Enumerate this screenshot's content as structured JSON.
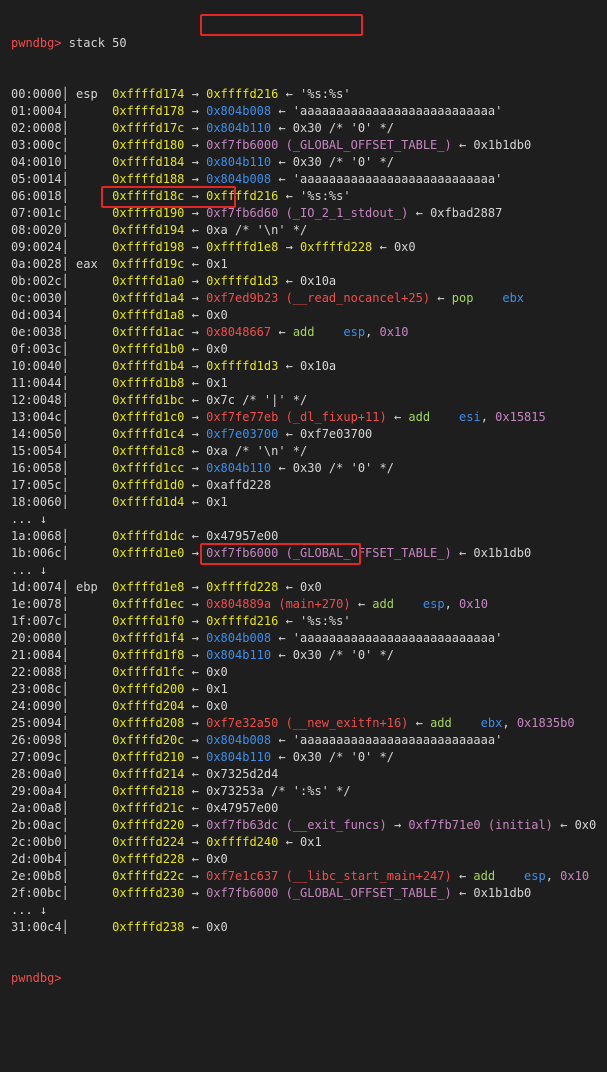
{
  "terminal": {
    "prompt": "pwndbg>",
    "command": " stack 50",
    "lines": [
      [
        [
          "00:0000",
          "plain"
        ],
        [
          "│ esp  ",
          "plain"
        ],
        [
          "0xffffd174",
          "addr"
        ],
        [
          " → ",
          "plain"
        ],
        [
          "0xffffd216",
          "addr"
        ],
        [
          " ← '%s:%s'",
          "plain"
        ]
      ],
      [
        [
          "01:0004",
          "plain"
        ],
        [
          "│      ",
          "plain"
        ],
        [
          "0xffffd178",
          "addr"
        ],
        [
          " → ",
          "plain"
        ],
        [
          "0x804b008",
          "blue"
        ],
        [
          " ← 'aaaaaaaaaaaaaaaaaaaaaaaaaaa'",
          "plain"
        ]
      ],
      [
        [
          "02:0008",
          "plain"
        ],
        [
          "│      ",
          "plain"
        ],
        [
          "0xffffd17c",
          "addr"
        ],
        [
          " → ",
          "plain"
        ],
        [
          "0x804b110",
          "blue"
        ],
        [
          " ← 0x30 /* '0' */",
          "plain"
        ]
      ],
      [
        [
          "03:000c",
          "plain"
        ],
        [
          "│      ",
          "plain"
        ],
        [
          "0xffffd180",
          "addr"
        ],
        [
          " → ",
          "plain"
        ],
        [
          "0xf7fb6000",
          "sym"
        ],
        [
          " (_GLOBAL_OFFSET_TABLE_)",
          "sym"
        ],
        [
          " ← 0x1b1db0",
          "plain"
        ]
      ],
      [
        [
          "04:0010",
          "plain"
        ],
        [
          "│      ",
          "plain"
        ],
        [
          "0xffffd184",
          "addr"
        ],
        [
          " → ",
          "plain"
        ],
        [
          "0x804b110",
          "blue"
        ],
        [
          " ← 0x30 /* '0' */",
          "plain"
        ]
      ],
      [
        [
          "05:0014",
          "plain"
        ],
        [
          "│      ",
          "plain"
        ],
        [
          "0xffffd188",
          "addr"
        ],
        [
          " → ",
          "plain"
        ],
        [
          "0x804b008",
          "blue"
        ],
        [
          " ← 'aaaaaaaaaaaaaaaaaaaaaaaaaaa'",
          "plain"
        ]
      ],
      [
        [
          "06:0018",
          "plain"
        ],
        [
          "│      ",
          "plain"
        ],
        [
          "0xffffd18c",
          "addr"
        ],
        [
          " → ",
          "plain"
        ],
        [
          "0xffffd216",
          "addr"
        ],
        [
          " ← '%s:%s'",
          "plain"
        ]
      ],
      [
        [
          "07:001c",
          "plain"
        ],
        [
          "│      ",
          "plain"
        ],
        [
          "0xffffd190",
          "addr"
        ],
        [
          " → ",
          "plain"
        ],
        [
          "0xf7fb6d60",
          "sym"
        ],
        [
          " (_IO_2_1_stdout_)",
          "sym"
        ],
        [
          " ← 0xfbad2887",
          "plain"
        ]
      ],
      [
        [
          "08:0020",
          "plain"
        ],
        [
          "│      ",
          "plain"
        ],
        [
          "0xffffd194",
          "addr"
        ],
        [
          " ← 0xa /* '\\n' */",
          "plain"
        ]
      ],
      [
        [
          "09:0024",
          "plain"
        ],
        [
          "│      ",
          "plain"
        ],
        [
          "0xffffd198",
          "addr"
        ],
        [
          " → ",
          "plain"
        ],
        [
          "0xffffd1e8",
          "addr"
        ],
        [
          " → ",
          "plain"
        ],
        [
          "0xffffd228",
          "addr"
        ],
        [
          " ← 0x0",
          "plain"
        ]
      ],
      [
        [
          "0a:0028",
          "plain"
        ],
        [
          "│ eax  ",
          "plain"
        ],
        [
          "0xffffd19c",
          "addr"
        ],
        [
          " ← 0x1",
          "plain"
        ]
      ],
      [
        [
          "0b:002c",
          "plain"
        ],
        [
          "│      ",
          "plain"
        ],
        [
          "0xffffd1a0",
          "addr"
        ],
        [
          " → ",
          "plain"
        ],
        [
          "0xffffd1d3",
          "addr"
        ],
        [
          " ← 0x10a",
          "plain"
        ]
      ],
      [
        [
          "0c:0030",
          "plain"
        ],
        [
          "│      ",
          "plain"
        ],
        [
          "0xffffd1a4",
          "addr"
        ],
        [
          " → ",
          "plain"
        ],
        [
          "0xf7ed9b23",
          "code"
        ],
        [
          " (__read_nocancel+25)",
          "code"
        ],
        [
          " ← ",
          "plain"
        ],
        [
          "pop",
          "ins"
        ],
        [
          "    ",
          "plain"
        ],
        [
          "ebx",
          "reg"
        ]
      ],
      [
        [
          "0d:0034",
          "plain"
        ],
        [
          "│      ",
          "plain"
        ],
        [
          "0xffffd1a8",
          "addr"
        ],
        [
          " ← 0x0",
          "plain"
        ]
      ],
      [
        [
          "0e:0038",
          "plain"
        ],
        [
          "│      ",
          "plain"
        ],
        [
          "0xffffd1ac",
          "addr"
        ],
        [
          " → ",
          "plain"
        ],
        [
          "0x8048667",
          "code"
        ],
        [
          " ← ",
          "plain"
        ],
        [
          "add",
          "ins"
        ],
        [
          "    ",
          "plain"
        ],
        [
          "esp",
          "reg"
        ],
        [
          ", ",
          "plain"
        ],
        [
          "0x10",
          "imm"
        ]
      ],
      [
        [
          "0f:003c",
          "plain"
        ],
        [
          "│      ",
          "plain"
        ],
        [
          "0xffffd1b0",
          "addr"
        ],
        [
          " ← 0x0",
          "plain"
        ]
      ],
      [
        [
          "10:0040",
          "plain"
        ],
        [
          "│      ",
          "plain"
        ],
        [
          "0xffffd1b4",
          "addr"
        ],
        [
          " → ",
          "plain"
        ],
        [
          "0xffffd1d3",
          "addr"
        ],
        [
          " ← 0x10a",
          "plain"
        ]
      ],
      [
        [
          "11:0044",
          "plain"
        ],
        [
          "│      ",
          "plain"
        ],
        [
          "0xffffd1b8",
          "addr"
        ],
        [
          " ← 0x1",
          "plain"
        ]
      ],
      [
        [
          "12:0048",
          "plain"
        ],
        [
          "│      ",
          "plain"
        ],
        [
          "0xffffd1bc",
          "addr"
        ],
        [
          " ← 0x7c /* '|' */",
          "plain"
        ]
      ],
      [
        [
          "13:004c",
          "plain"
        ],
        [
          "│      ",
          "plain"
        ],
        [
          "0xffffd1c0",
          "addr"
        ],
        [
          " → ",
          "plain"
        ],
        [
          "0xf7fe77eb",
          "code"
        ],
        [
          " (_dl_fixup+11)",
          "code"
        ],
        [
          " ← ",
          "plain"
        ],
        [
          "add",
          "ins"
        ],
        [
          "    ",
          "plain"
        ],
        [
          "esi",
          "reg"
        ],
        [
          ", ",
          "plain"
        ],
        [
          "0x15815",
          "imm"
        ]
      ],
      [
        [
          "14:0050",
          "plain"
        ],
        [
          "│      ",
          "plain"
        ],
        [
          "0xffffd1c4",
          "addr"
        ],
        [
          " → ",
          "plain"
        ],
        [
          "0xf7e03700",
          "blue"
        ],
        [
          " ← 0xf7e03700",
          "plain"
        ]
      ],
      [
        [
          "15:0054",
          "plain"
        ],
        [
          "│      ",
          "plain"
        ],
        [
          "0xffffd1c8",
          "addr"
        ],
        [
          " ← 0xa /* '\\n' */",
          "plain"
        ]
      ],
      [
        [
          "16:0058",
          "plain"
        ],
        [
          "│      ",
          "plain"
        ],
        [
          "0xffffd1cc",
          "addr"
        ],
        [
          " → ",
          "plain"
        ],
        [
          "0x804b110",
          "blue"
        ],
        [
          " ← 0x30 /* '0' */",
          "plain"
        ]
      ],
      [
        [
          "17:005c",
          "plain"
        ],
        [
          "│      ",
          "plain"
        ],
        [
          "0xffffd1d0",
          "addr"
        ],
        [
          " ← 0xaffd228",
          "plain"
        ]
      ],
      [
        [
          "18:0060",
          "plain"
        ],
        [
          "│      ",
          "plain"
        ],
        [
          "0xffffd1d4",
          "addr"
        ],
        [
          " ← 0x1",
          "plain"
        ]
      ],
      [
        [
          "... ↓",
          "plain"
        ]
      ],
      [
        [
          "1a:0068",
          "plain"
        ],
        [
          "│      ",
          "plain"
        ],
        [
          "0xffffd1dc",
          "addr"
        ],
        [
          " ← 0x47957e00",
          "plain"
        ]
      ],
      [
        [
          "1b:006c",
          "plain"
        ],
        [
          "│      ",
          "plain"
        ],
        [
          "0xffffd1e0",
          "addr"
        ],
        [
          " → ",
          "plain"
        ],
        [
          "0xf7fb6000",
          "sym"
        ],
        [
          " (_GLOBAL_OFFSET_TABLE_)",
          "sym"
        ],
        [
          " ← 0x1b1db0",
          "plain"
        ]
      ],
      [
        [
          "... ↓",
          "plain"
        ]
      ],
      [
        [
          "1d:0074",
          "plain"
        ],
        [
          "│ ebp  ",
          "plain"
        ],
        [
          "0xffffd1e8",
          "addr"
        ],
        [
          " → ",
          "plain"
        ],
        [
          "0xffffd228",
          "addr"
        ],
        [
          " ← 0x0",
          "plain"
        ]
      ],
      [
        [
          "1e:0078",
          "plain"
        ],
        [
          "│      ",
          "plain"
        ],
        [
          "0xffffd1ec",
          "addr"
        ],
        [
          " → ",
          "plain"
        ],
        [
          "0x804889a",
          "code"
        ],
        [
          " (main+270)",
          "code"
        ],
        [
          " ← ",
          "plain"
        ],
        [
          "add",
          "ins"
        ],
        [
          "    ",
          "plain"
        ],
        [
          "esp",
          "reg"
        ],
        [
          ", ",
          "plain"
        ],
        [
          "0x10",
          "imm"
        ]
      ],
      [
        [
          "1f:007c",
          "plain"
        ],
        [
          "│      ",
          "plain"
        ],
        [
          "0xffffd1f0",
          "addr"
        ],
        [
          " → ",
          "plain"
        ],
        [
          "0xffffd216",
          "addr"
        ],
        [
          " ← '%s:%s'",
          "plain"
        ]
      ],
      [
        [
          "20:0080",
          "plain"
        ],
        [
          "│      ",
          "plain"
        ],
        [
          "0xffffd1f4",
          "addr"
        ],
        [
          " → ",
          "plain"
        ],
        [
          "0x804b008",
          "blue"
        ],
        [
          " ← 'aaaaaaaaaaaaaaaaaaaaaaaaaaa'",
          "plain"
        ]
      ],
      [
        [
          "21:0084",
          "plain"
        ],
        [
          "│      ",
          "plain"
        ],
        [
          "0xffffd1f8",
          "addr"
        ],
        [
          " → ",
          "plain"
        ],
        [
          "0x804b110",
          "blue"
        ],
        [
          " ← 0x30 /* '0' */",
          "plain"
        ]
      ],
      [
        [
          "22:0088",
          "plain"
        ],
        [
          "│      ",
          "plain"
        ],
        [
          "0xffffd1fc",
          "addr"
        ],
        [
          " ← 0x0",
          "plain"
        ]
      ],
      [
        [
          "23:008c",
          "plain"
        ],
        [
          "│      ",
          "plain"
        ],
        [
          "0xffffd200",
          "addr"
        ],
        [
          " ← 0x1",
          "plain"
        ]
      ],
      [
        [
          "24:0090",
          "plain"
        ],
        [
          "│      ",
          "plain"
        ],
        [
          "0xffffd204",
          "addr"
        ],
        [
          " ← 0x0",
          "plain"
        ]
      ],
      [
        [
          "25:0094",
          "plain"
        ],
        [
          "│      ",
          "plain"
        ],
        [
          "0xffffd208",
          "addr"
        ],
        [
          " → ",
          "plain"
        ],
        [
          "0xf7e32a50",
          "code"
        ],
        [
          " (__new_exitfn+16)",
          "code"
        ],
        [
          " ← ",
          "plain"
        ],
        [
          "add",
          "ins"
        ],
        [
          "    ",
          "plain"
        ],
        [
          "ebx",
          "reg"
        ],
        [
          ", ",
          "plain"
        ],
        [
          "0x1835b0",
          "imm"
        ]
      ],
      [
        [
          "26:0098",
          "plain"
        ],
        [
          "│      ",
          "plain"
        ],
        [
          "0xffffd20c",
          "addr"
        ],
        [
          " → ",
          "plain"
        ],
        [
          "0x804b008",
          "blue"
        ],
        [
          " ← 'aaaaaaaaaaaaaaaaaaaaaaaaaaa'",
          "plain"
        ]
      ],
      [
        [
          "27:009c",
          "plain"
        ],
        [
          "│      ",
          "plain"
        ],
        [
          "0xffffd210",
          "addr"
        ],
        [
          " → ",
          "plain"
        ],
        [
          "0x804b110",
          "blue"
        ],
        [
          " ← 0x30 /* '0' */",
          "plain"
        ]
      ],
      [
        [
          "28:00a0",
          "plain"
        ],
        [
          "│      ",
          "plain"
        ],
        [
          "0xffffd214",
          "addr"
        ],
        [
          " ← 0x7325d2d4",
          "plain"
        ]
      ],
      [
        [
          "29:00a4",
          "plain"
        ],
        [
          "│      ",
          "plain"
        ],
        [
          "0xffffd218",
          "addr"
        ],
        [
          " ← 0x73253a /* ':%s' */",
          "plain"
        ]
      ],
      [
        [
          "2a:00a8",
          "plain"
        ],
        [
          "│      ",
          "plain"
        ],
        [
          "0xffffd21c",
          "addr"
        ],
        [
          " ← 0x47957e00",
          "plain"
        ]
      ],
      [
        [
          "2b:00ac",
          "plain"
        ],
        [
          "│      ",
          "plain"
        ],
        [
          "0xffffd220",
          "addr"
        ],
        [
          " → ",
          "plain"
        ],
        [
          "0xf7fb63dc",
          "sym"
        ],
        [
          " (__exit_funcs)",
          "sym"
        ],
        [
          " → ",
          "plain"
        ],
        [
          "0xf7fb71e0",
          "sym"
        ],
        [
          " (initial)",
          "sym"
        ],
        [
          " ← 0x0",
          "plain"
        ]
      ],
      [
        [
          "2c:00b0",
          "plain"
        ],
        [
          "│      ",
          "plain"
        ],
        [
          "0xffffd224",
          "addr"
        ],
        [
          " → ",
          "plain"
        ],
        [
          "0xffffd240",
          "addr"
        ],
        [
          " ← 0x1",
          "plain"
        ]
      ],
      [
        [
          "2d:00b4",
          "plain"
        ],
        [
          "│      ",
          "plain"
        ],
        [
          "0xffffd228",
          "addr"
        ],
        [
          " ← 0x0",
          "plain"
        ]
      ],
      [
        [
          "2e:00b8",
          "plain"
        ],
        [
          "│      ",
          "plain"
        ],
        [
          "0xffffd22c",
          "addr"
        ],
        [
          " → ",
          "plain"
        ],
        [
          "0xf7e1c637",
          "code"
        ],
        [
          " (__libc_start_main+247)",
          "code"
        ],
        [
          " ← ",
          "plain"
        ],
        [
          "add",
          "ins"
        ],
        [
          "    ",
          "plain"
        ],
        [
          "esp",
          "reg"
        ],
        [
          ", ",
          "plain"
        ],
        [
          "0x10",
          "imm"
        ]
      ],
      [
        [
          "2f:00bc",
          "plain"
        ],
        [
          "│      ",
          "plain"
        ],
        [
          "0xffffd230",
          "addr"
        ],
        [
          " → ",
          "plain"
        ],
        [
          "0xf7fb6000",
          "sym"
        ],
        [
          " (_GLOBAL_OFFSET_TABLE_)",
          "sym"
        ],
        [
          " ← 0x1b1db0",
          "plain"
        ]
      ],
      [
        [
          "... ↓",
          "plain"
        ]
      ],
      [
        [
          "31:00c4",
          "plain"
        ],
        [
          "│      ",
          "plain"
        ],
        [
          "0xffffd238",
          "addr"
        ],
        [
          " ← 0x0",
          "plain"
        ]
      ]
    ],
    "end_prompt": "pwndbg>"
  },
  "colors": {
    "background": "#1e1e1e",
    "text": "#d4d4d4",
    "prompt": "#f14c4c",
    "stack_address": "#e5e510",
    "code_pointer": "#f14c4c",
    "data_pointer": "#3b8eea",
    "symbol_pointer": "#c586c0",
    "instruction": "#a3d65a",
    "highlight_box": "#e32626"
  }
}
